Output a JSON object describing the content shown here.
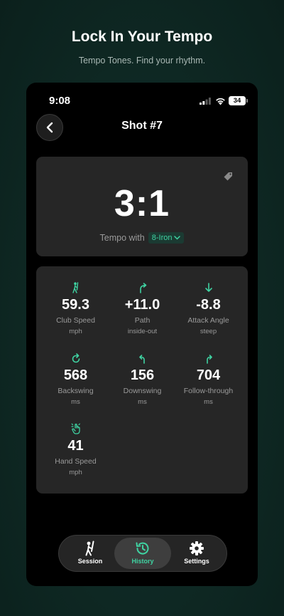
{
  "promo": {
    "title": "Lock In Your Tempo",
    "subtitle": "Tempo Tones. Find your rhythm."
  },
  "status_bar": {
    "time": "9:08",
    "battery": "34"
  },
  "nav": {
    "title": "Shot #7"
  },
  "tempo": {
    "ratio": "3:1",
    "label": "Tempo with",
    "club": "8-Iron"
  },
  "metrics": [
    {
      "icon": "golfer-icon",
      "value": "59.3",
      "label": "Club Speed",
      "unit": "mph"
    },
    {
      "icon": "arrow-up-right-icon",
      "value": "+11.0",
      "label": "Path",
      "unit": "inside-out"
    },
    {
      "icon": "arrow-down-icon",
      "value": "-8.8",
      "label": "Attack Angle",
      "unit": "steep"
    },
    {
      "icon": "rotate-cw-icon",
      "value": "568",
      "label": "Backswing",
      "unit": "ms"
    },
    {
      "icon": "rotate-ccw-icon",
      "value": "156",
      "label": "Downswing",
      "unit": "ms"
    },
    {
      "icon": "arrow-up-return-icon",
      "value": "704",
      "label": "Follow-through",
      "unit": "ms"
    },
    {
      "icon": "hand-tap-icon",
      "value": "41",
      "label": "Hand Speed",
      "unit": "mph"
    }
  ],
  "tabs": [
    {
      "label": "Session",
      "icon": "golfer-icon"
    },
    {
      "label": "History",
      "icon": "history-icon",
      "active": true
    },
    {
      "label": "Settings",
      "icon": "gear-icon"
    }
  ],
  "colors": {
    "accent": "#3fd3a2",
    "card": "#262626",
    "screen": "#000000",
    "background": "#0f2a25"
  }
}
